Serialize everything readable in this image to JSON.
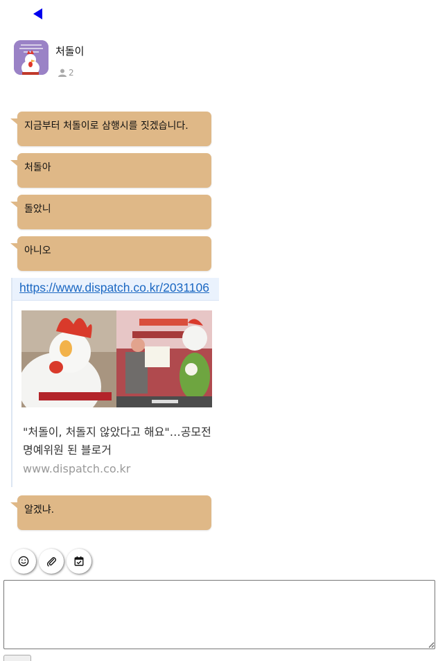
{
  "nav": {
    "back_icon": "back-arrow-icon"
  },
  "room": {
    "title": "처돌이",
    "member_count": "2",
    "avatar_icon": "rooster-mascot-avatar"
  },
  "messages": [
    {
      "text": "지금부터 처돌이로 삼행시를 짓겠습니다."
    },
    {
      "text": "처돌아"
    },
    {
      "text": "돌았니"
    },
    {
      "text": "아니오"
    },
    {
      "text": "알겠냐."
    }
  ],
  "link_preview": {
    "url": "https://www.dispatch.co.kr/2031106",
    "title": "\"처돌이, 처돌지 않았다고 해요\"…공모전 명예위원 된 블로거",
    "domain": "www.dispatch.co.kr",
    "thumbnail_icon": "rooster-mascot-photo"
  },
  "toolbar": {
    "emoji_icon": "smiley-icon",
    "attach_icon": "paperclip-icon",
    "schedule_icon": "calendar-check-icon"
  },
  "composer": {
    "value": "",
    "placeholder": ""
  },
  "colors": {
    "bubble": "#dfb887",
    "link_accent": "#1a67c2",
    "back_arrow": "#0000ee"
  }
}
